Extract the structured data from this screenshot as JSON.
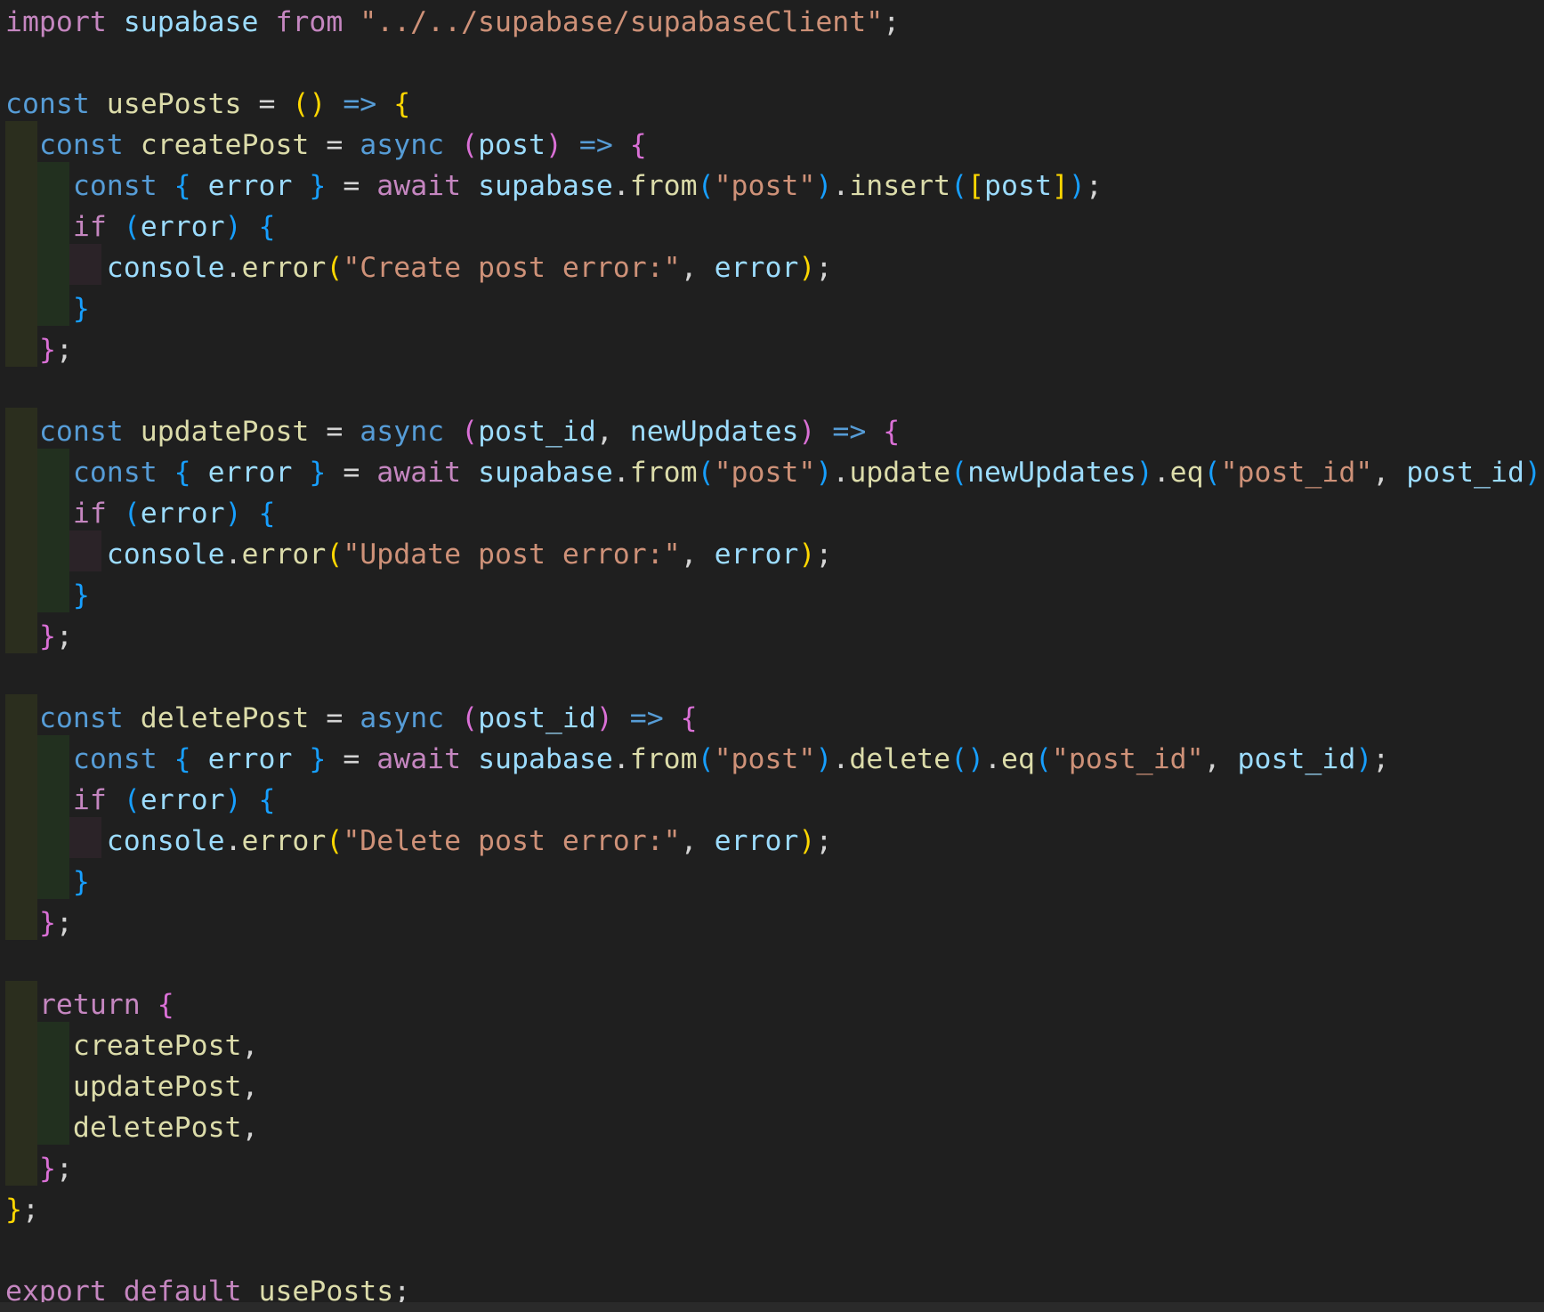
{
  "editor": {
    "language": "javascript",
    "theme": "dark",
    "lines": [
      [
        [
          "kw-purple",
          "import"
        ],
        [
          "plain",
          " "
        ],
        [
          "var",
          "supabase"
        ],
        [
          "plain",
          " "
        ],
        [
          "kw-purple",
          "from"
        ],
        [
          "plain",
          " "
        ],
        [
          "str",
          "\"../../supabase/supabaseClient\""
        ],
        [
          "punc",
          ";"
        ]
      ],
      [],
      [
        [
          "kw-blue",
          "const"
        ],
        [
          "plain",
          " "
        ],
        [
          "fn",
          "usePosts"
        ],
        [
          "plain",
          " "
        ],
        [
          "op",
          "="
        ],
        [
          "plain",
          " "
        ],
        [
          "b-yellow",
          "()"
        ],
        [
          "plain",
          " "
        ],
        [
          "kw-blue",
          "=>"
        ],
        [
          "plain",
          " "
        ],
        [
          "b-yellow",
          "{"
        ]
      ],
      [
        [
          "plain",
          "  "
        ],
        [
          "kw-blue",
          "const"
        ],
        [
          "plain",
          " "
        ],
        [
          "fn",
          "createPost"
        ],
        [
          "plain",
          " "
        ],
        [
          "op",
          "="
        ],
        [
          "plain",
          " "
        ],
        [
          "kw-blue",
          "async"
        ],
        [
          "plain",
          " "
        ],
        [
          "b-pink",
          "("
        ],
        [
          "var",
          "post"
        ],
        [
          "b-pink",
          ")"
        ],
        [
          "plain",
          " "
        ],
        [
          "kw-blue",
          "=>"
        ],
        [
          "plain",
          " "
        ],
        [
          "b-pink",
          "{"
        ]
      ],
      [
        [
          "plain",
          "    "
        ],
        [
          "kw-blue",
          "const"
        ],
        [
          "plain",
          " "
        ],
        [
          "b-blue",
          "{"
        ],
        [
          "plain",
          " "
        ],
        [
          "var",
          "error"
        ],
        [
          "plain",
          " "
        ],
        [
          "b-blue",
          "}"
        ],
        [
          "plain",
          " "
        ],
        [
          "op",
          "="
        ],
        [
          "plain",
          " "
        ],
        [
          "kw-purple",
          "await"
        ],
        [
          "plain",
          " "
        ],
        [
          "var",
          "supabase"
        ],
        [
          "punc",
          "."
        ],
        [
          "fn",
          "from"
        ],
        [
          "b-blue",
          "("
        ],
        [
          "str",
          "\"post\""
        ],
        [
          "b-blue",
          ")"
        ],
        [
          "punc",
          "."
        ],
        [
          "fn",
          "insert"
        ],
        [
          "b-blue",
          "("
        ],
        [
          "b-yellow",
          "["
        ],
        [
          "var",
          "post"
        ],
        [
          "b-yellow",
          "]"
        ],
        [
          "b-blue",
          ")"
        ],
        [
          "punc",
          ";"
        ]
      ],
      [
        [
          "plain",
          "    "
        ],
        [
          "kw-purple",
          "if"
        ],
        [
          "plain",
          " "
        ],
        [
          "b-blue",
          "("
        ],
        [
          "var",
          "error"
        ],
        [
          "b-blue",
          ")"
        ],
        [
          "plain",
          " "
        ],
        [
          "b-blue",
          "{"
        ]
      ],
      [
        [
          "plain",
          "      "
        ],
        [
          "var",
          "console"
        ],
        [
          "punc",
          "."
        ],
        [
          "fn",
          "error"
        ],
        [
          "b-yellow",
          "("
        ],
        [
          "str",
          "\"Create post error:\""
        ],
        [
          "punc",
          ","
        ],
        [
          "plain",
          " "
        ],
        [
          "var",
          "error"
        ],
        [
          "b-yellow",
          ")"
        ],
        [
          "punc",
          ";"
        ]
      ],
      [
        [
          "plain",
          "    "
        ],
        [
          "b-blue",
          "}"
        ]
      ],
      [
        [
          "plain",
          "  "
        ],
        [
          "b-pink",
          "}"
        ],
        [
          "punc",
          ";"
        ]
      ],
      [],
      [
        [
          "plain",
          "  "
        ],
        [
          "kw-blue",
          "const"
        ],
        [
          "plain",
          " "
        ],
        [
          "fn",
          "updatePost"
        ],
        [
          "plain",
          " "
        ],
        [
          "op",
          "="
        ],
        [
          "plain",
          " "
        ],
        [
          "kw-blue",
          "async"
        ],
        [
          "plain",
          " "
        ],
        [
          "b-pink",
          "("
        ],
        [
          "var",
          "post_id"
        ],
        [
          "punc",
          ","
        ],
        [
          "plain",
          " "
        ],
        [
          "var",
          "newUpdates"
        ],
        [
          "b-pink",
          ")"
        ],
        [
          "plain",
          " "
        ],
        [
          "kw-blue",
          "=>"
        ],
        [
          "plain",
          " "
        ],
        [
          "b-pink",
          "{"
        ]
      ],
      [
        [
          "plain",
          "    "
        ],
        [
          "kw-blue",
          "const"
        ],
        [
          "plain",
          " "
        ],
        [
          "b-blue",
          "{"
        ],
        [
          "plain",
          " "
        ],
        [
          "var",
          "error"
        ],
        [
          "plain",
          " "
        ],
        [
          "b-blue",
          "}"
        ],
        [
          "plain",
          " "
        ],
        [
          "op",
          "="
        ],
        [
          "plain",
          " "
        ],
        [
          "kw-purple",
          "await"
        ],
        [
          "plain",
          " "
        ],
        [
          "var",
          "supabase"
        ],
        [
          "punc",
          "."
        ],
        [
          "fn",
          "from"
        ],
        [
          "b-blue",
          "("
        ],
        [
          "str",
          "\"post\""
        ],
        [
          "b-blue",
          ")"
        ],
        [
          "punc",
          "."
        ],
        [
          "fn",
          "update"
        ],
        [
          "b-blue",
          "("
        ],
        [
          "var",
          "newUpdates"
        ],
        [
          "b-blue",
          ")"
        ],
        [
          "punc",
          "."
        ],
        [
          "fn",
          "eq"
        ],
        [
          "b-blue",
          "("
        ],
        [
          "str",
          "\"post_id\""
        ],
        [
          "punc",
          ","
        ],
        [
          "plain",
          " "
        ],
        [
          "var",
          "post_id"
        ],
        [
          "b-blue",
          ")"
        ],
        [
          "punc",
          ";"
        ]
      ],
      [
        [
          "plain",
          "    "
        ],
        [
          "kw-purple",
          "if"
        ],
        [
          "plain",
          " "
        ],
        [
          "b-blue",
          "("
        ],
        [
          "var",
          "error"
        ],
        [
          "b-blue",
          ")"
        ],
        [
          "plain",
          " "
        ],
        [
          "b-blue",
          "{"
        ]
      ],
      [
        [
          "plain",
          "      "
        ],
        [
          "var",
          "console"
        ],
        [
          "punc",
          "."
        ],
        [
          "fn",
          "error"
        ],
        [
          "b-yellow",
          "("
        ],
        [
          "str",
          "\"Update post error:\""
        ],
        [
          "punc",
          ","
        ],
        [
          "plain",
          " "
        ],
        [
          "var",
          "error"
        ],
        [
          "b-yellow",
          ")"
        ],
        [
          "punc",
          ";"
        ]
      ],
      [
        [
          "plain",
          "    "
        ],
        [
          "b-blue",
          "}"
        ]
      ],
      [
        [
          "plain",
          "  "
        ],
        [
          "b-pink",
          "}"
        ],
        [
          "punc",
          ";"
        ]
      ],
      [],
      [
        [
          "plain",
          "  "
        ],
        [
          "kw-blue",
          "const"
        ],
        [
          "plain",
          " "
        ],
        [
          "fn",
          "deletePost"
        ],
        [
          "plain",
          " "
        ],
        [
          "op",
          "="
        ],
        [
          "plain",
          " "
        ],
        [
          "kw-blue",
          "async"
        ],
        [
          "plain",
          " "
        ],
        [
          "b-pink",
          "("
        ],
        [
          "var",
          "post_id"
        ],
        [
          "b-pink",
          ")"
        ],
        [
          "plain",
          " "
        ],
        [
          "kw-blue",
          "=>"
        ],
        [
          "plain",
          " "
        ],
        [
          "b-pink",
          "{"
        ]
      ],
      [
        [
          "plain",
          "    "
        ],
        [
          "kw-blue",
          "const"
        ],
        [
          "plain",
          " "
        ],
        [
          "b-blue",
          "{"
        ],
        [
          "plain",
          " "
        ],
        [
          "var",
          "error"
        ],
        [
          "plain",
          " "
        ],
        [
          "b-blue",
          "}"
        ],
        [
          "plain",
          " "
        ],
        [
          "op",
          "="
        ],
        [
          "plain",
          " "
        ],
        [
          "kw-purple",
          "await"
        ],
        [
          "plain",
          " "
        ],
        [
          "var",
          "supabase"
        ],
        [
          "punc",
          "."
        ],
        [
          "fn",
          "from"
        ],
        [
          "b-blue",
          "("
        ],
        [
          "str",
          "\"post\""
        ],
        [
          "b-blue",
          ")"
        ],
        [
          "punc",
          "."
        ],
        [
          "fn",
          "delete"
        ],
        [
          "b-blue",
          "()"
        ],
        [
          "punc",
          "."
        ],
        [
          "fn",
          "eq"
        ],
        [
          "b-blue",
          "("
        ],
        [
          "str",
          "\"post_id\""
        ],
        [
          "punc",
          ","
        ],
        [
          "plain",
          " "
        ],
        [
          "var",
          "post_id"
        ],
        [
          "b-blue",
          ")"
        ],
        [
          "punc",
          ";"
        ]
      ],
      [
        [
          "plain",
          "    "
        ],
        [
          "kw-purple",
          "if"
        ],
        [
          "plain",
          " "
        ],
        [
          "b-blue",
          "("
        ],
        [
          "var",
          "error"
        ],
        [
          "b-blue",
          ")"
        ],
        [
          "plain",
          " "
        ],
        [
          "b-blue",
          "{"
        ]
      ],
      [
        [
          "plain",
          "      "
        ],
        [
          "var",
          "console"
        ],
        [
          "punc",
          "."
        ],
        [
          "fn",
          "error"
        ],
        [
          "b-yellow",
          "("
        ],
        [
          "str",
          "\"Delete post error:\""
        ],
        [
          "punc",
          ","
        ],
        [
          "plain",
          " "
        ],
        [
          "var",
          "error"
        ],
        [
          "b-yellow",
          ")"
        ],
        [
          "punc",
          ";"
        ]
      ],
      [
        [
          "plain",
          "    "
        ],
        [
          "b-blue",
          "}"
        ]
      ],
      [
        [
          "plain",
          "  "
        ],
        [
          "b-pink",
          "}"
        ],
        [
          "punc",
          ";"
        ]
      ],
      [],
      [
        [
          "plain",
          "  "
        ],
        [
          "kw-purple",
          "return"
        ],
        [
          "plain",
          " "
        ],
        [
          "b-pink",
          "{"
        ]
      ],
      [
        [
          "plain",
          "    "
        ],
        [
          "fn",
          "createPost"
        ],
        [
          "punc",
          ","
        ]
      ],
      [
        [
          "plain",
          "    "
        ],
        [
          "fn",
          "updatePost"
        ],
        [
          "punc",
          ","
        ]
      ],
      [
        [
          "plain",
          "    "
        ],
        [
          "fn",
          "deletePost"
        ],
        [
          "punc",
          ","
        ]
      ],
      [
        [
          "plain",
          "  "
        ],
        [
          "b-pink",
          "}"
        ],
        [
          "punc",
          ";"
        ]
      ],
      [
        [
          "b-yellow",
          "}"
        ],
        [
          "punc",
          ";"
        ]
      ],
      [],
      [
        [
          "kw-purple",
          "export"
        ],
        [
          "plain",
          " "
        ],
        [
          "kw-purple",
          "default"
        ],
        [
          "plain",
          " "
        ],
        [
          "fn",
          "usePosts"
        ],
        [
          "punc",
          ";"
        ]
      ]
    ]
  }
}
